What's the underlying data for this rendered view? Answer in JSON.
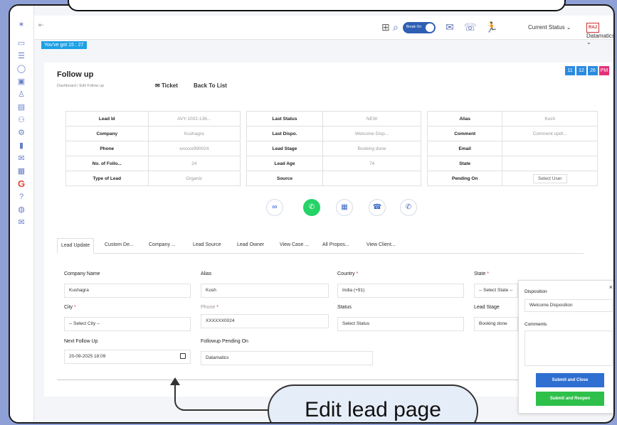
{
  "header": {
    "toggle_label": "Break On",
    "current_status": "Current Status",
    "brand_logo_text": "RAJ",
    "brand": "Datamatics"
  },
  "timer": "You've got 15 : 27",
  "page": {
    "title": "Follow up",
    "breadcrumb": "Dashboard / Edit Follow up",
    "ticket": "Ticket",
    "back": "Back To List",
    "badges": [
      "11",
      "12",
      "26",
      "PM"
    ]
  },
  "info_table_1": [
    {
      "k": "Lead Id",
      "v": "AVY-1002-136..."
    },
    {
      "k": "Company",
      "v": "Kushagra"
    },
    {
      "k": "Phone",
      "v": "xxxxxx990024"
    },
    {
      "k": "No. of Follo...",
      "v": "24"
    },
    {
      "k": "Type of Lead",
      "v": "Organic"
    }
  ],
  "info_table_2": [
    {
      "k": "Last Status",
      "v": "NEW"
    },
    {
      "k": "Last Dispo.",
      "v": "Welcome Disp..."
    },
    {
      "k": "Lead Stage",
      "v": "Booking done"
    },
    {
      "k": "Lead Age",
      "v": "74"
    },
    {
      "k": "Source",
      "v": ""
    }
  ],
  "info_table_3": [
    {
      "k": "Alias",
      "v": "Kush"
    },
    {
      "k": "Comment",
      "v": "Comment updt..."
    },
    {
      "k": "Email",
      "v": ""
    },
    {
      "k": "State",
      "v": ""
    },
    {
      "k": "Pending On",
      "v": "Select User"
    }
  ],
  "tabs": [
    "Lead Update",
    "Custom De...",
    "Company ...",
    "Lead Source",
    "Lead Owner",
    "View Case ...",
    "All Propos...",
    "View Client..."
  ],
  "form": {
    "company_name_label": "Company Name",
    "company_name": "Kushagra",
    "alias_label": "Alias",
    "alias": "Kush",
    "country_label": "Country",
    "country": "India (+91)",
    "state_label": "State",
    "state": "-- Select State --",
    "city_label": "City",
    "city": "-- Select City --",
    "phone_label": "Phone",
    "phone": "XXXXXX0024",
    "status_label": "Status",
    "status": "Select Status",
    "lead_stage_label": "Lead Stage",
    "lead_stage": "Booking done",
    "next_follow_label": "Next Follow Up",
    "next_follow": "20-09-2025 18:09",
    "pending_on_label": "Followup Pending On",
    "pending_on": "Datamatics"
  },
  "disposition": {
    "title": "Disposition",
    "value": "Welcome Disposition",
    "comments_label": "Comments",
    "submit_close": "Submit and Close",
    "submit_reopen": "Submit and Reopen"
  },
  "callout": "Edit lead page",
  "colors": {
    "accent": "#2b8be0",
    "toggle": "#2f5fb3",
    "green": "#2ec04b",
    "blue_btn": "#2f6fd1",
    "pm": "#e4317a"
  }
}
